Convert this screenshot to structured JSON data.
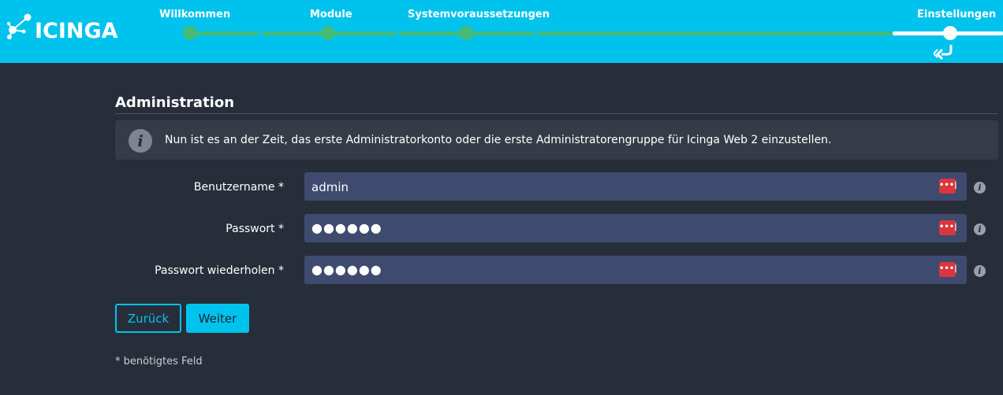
{
  "header": {
    "logo_text": "ICINGA",
    "steps": [
      {
        "label": "Willkommen",
        "state": "done"
      },
      {
        "label": "Module",
        "state": "done"
      },
      {
        "label": "Systemvoraussetzungen",
        "state": "done"
      },
      {
        "label": "Einstellungen",
        "state": "current"
      }
    ],
    "colors": {
      "bar": "#00c3ed",
      "done": "#44bb77",
      "current": "#ffffff"
    }
  },
  "main": {
    "title": "Administration",
    "notice": {
      "icon": "info-icon",
      "text": "Nun ist es an der Zeit, das erste Administratorkonto oder die erste Administratorengruppe für Icinga Web 2 einzustellen."
    },
    "fields": [
      {
        "label": "Benutzername *",
        "value": "admin",
        "type": "text"
      },
      {
        "label": "Passwort *",
        "value": "●●●●●●",
        "type": "password"
      },
      {
        "label": "Passwort wiederholen *",
        "value": "●●●●●●",
        "type": "password"
      }
    ],
    "buttons": {
      "back": "Zurück",
      "next": "Weiter"
    },
    "footnote": "* benötigtes Feld"
  },
  "colors": {
    "background": "#282e39",
    "accent": "#00c3ed",
    "input": "#3e4b6e",
    "password_manager": "#d9363e"
  }
}
